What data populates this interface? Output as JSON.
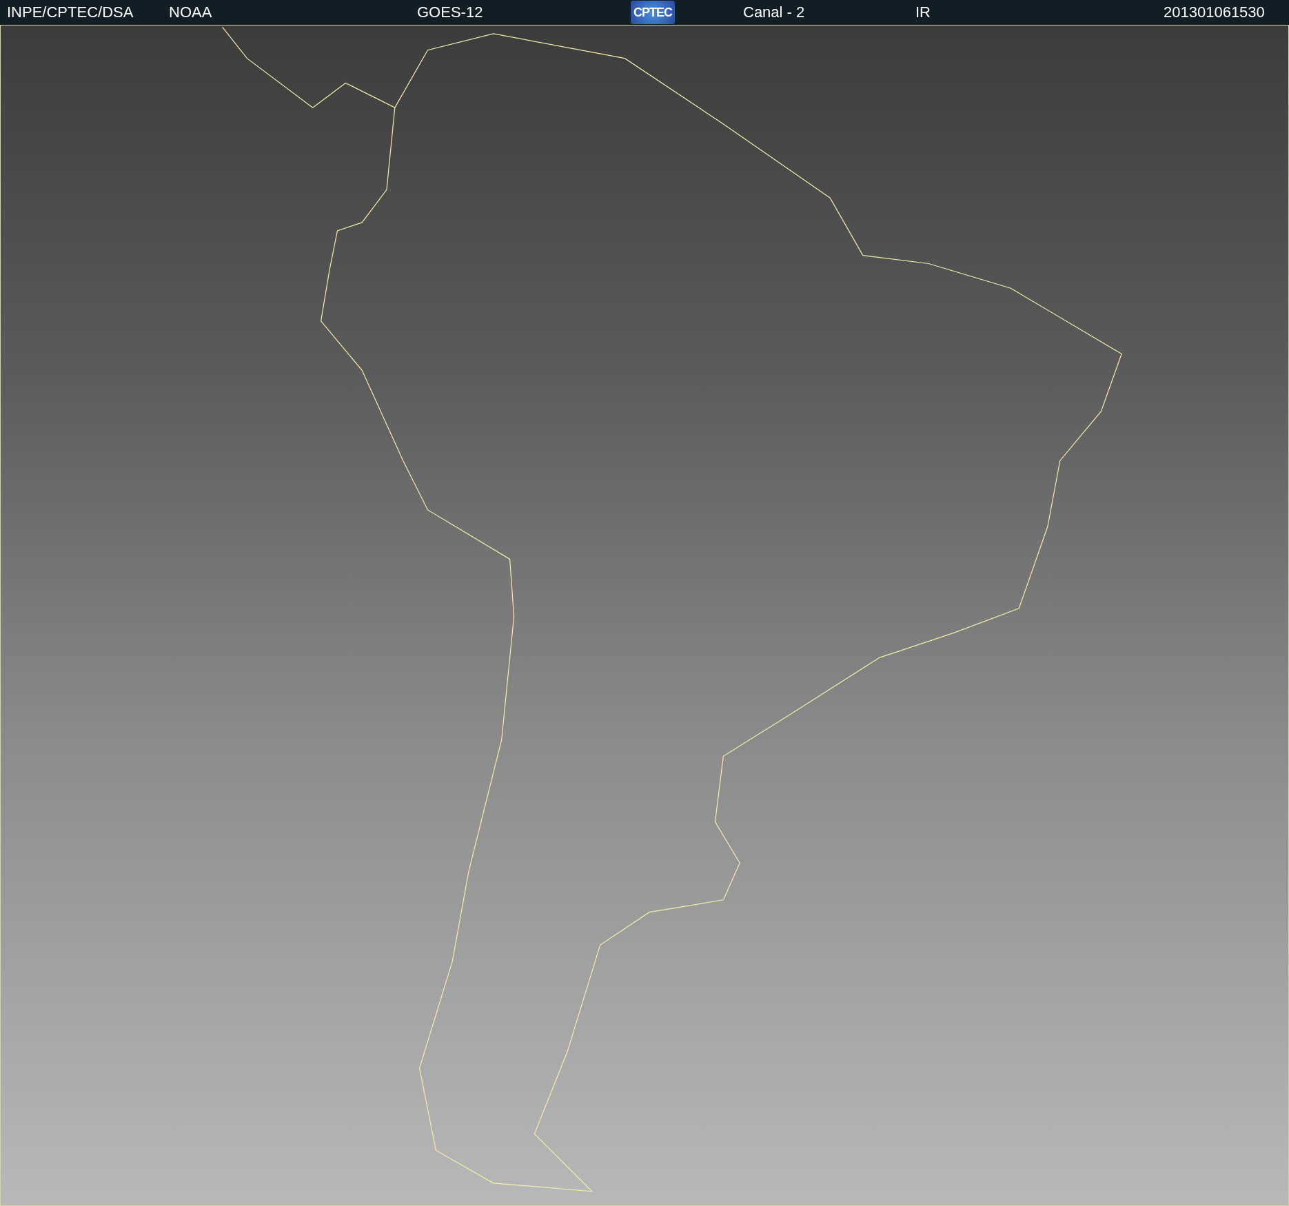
{
  "header": {
    "items": [
      {
        "kind": "text",
        "text": "INPE/CPTEC/DSA"
      },
      {
        "kind": "text",
        "text": "NOAA"
      },
      {
        "kind": "text",
        "text": "GOES-12"
      },
      {
        "kind": "logo",
        "text": "CPTEC"
      },
      {
        "kind": "text",
        "text": "Canal - 2"
      },
      {
        "kind": "text",
        "text": "IR"
      },
      {
        "kind": "text",
        "text": "201301061530"
      }
    ]
  }
}
